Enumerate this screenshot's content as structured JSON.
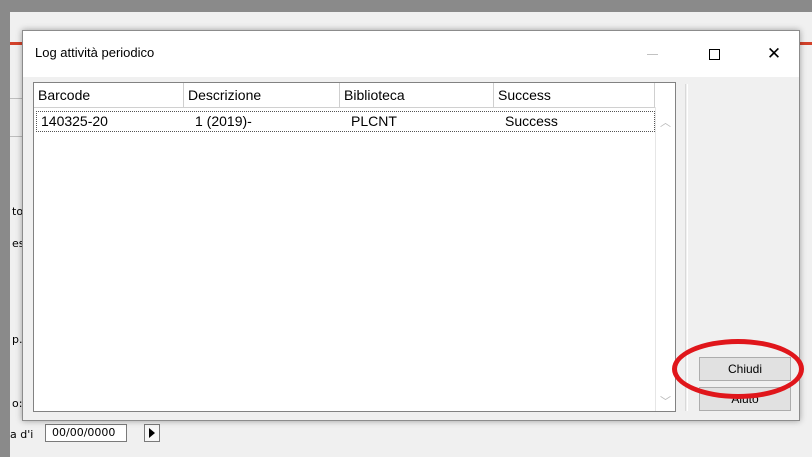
{
  "background": {
    "fragments": [
      "to",
      "es",
      "p.",
      "o:"
    ],
    "date_label": "a d'i",
    "date_value": "00/00/0000",
    "accent_color": "#d3412a"
  },
  "dialog": {
    "title": "Log attività periodico",
    "columns": [
      "Barcode",
      "Descrizione",
      "Biblioteca",
      "Success"
    ],
    "rows": [
      [
        "140325-20",
        "1 (2019)-",
        "PLCNT",
        "Success"
      ]
    ],
    "buttons": {
      "close_label": "Chiudi",
      "help_label": "Aiuto"
    },
    "highlight_color": "#e0161b"
  }
}
